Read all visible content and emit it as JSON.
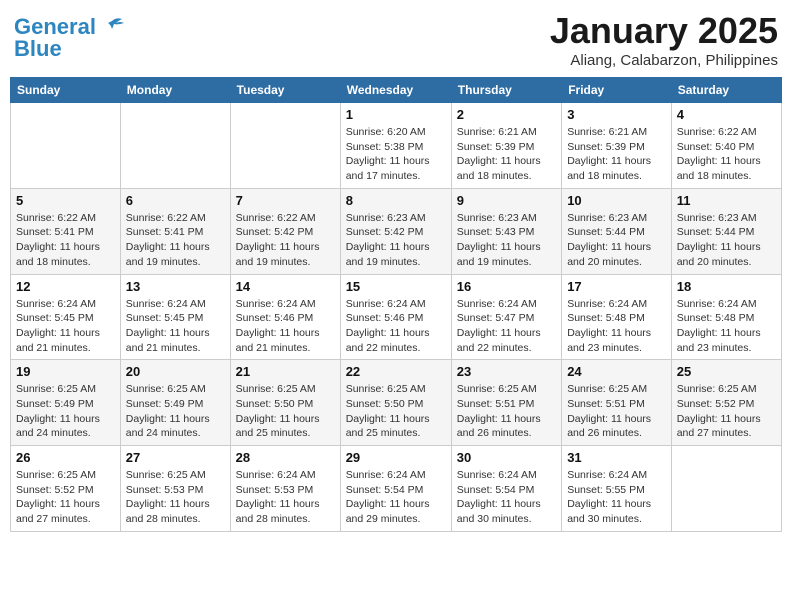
{
  "header": {
    "logo_line1": "General",
    "logo_line2": "Blue",
    "month": "January 2025",
    "location": "Aliang, Calabarzon, Philippines"
  },
  "weekdays": [
    "Sunday",
    "Monday",
    "Tuesday",
    "Wednesday",
    "Thursday",
    "Friday",
    "Saturday"
  ],
  "weeks": [
    [
      {
        "day": "",
        "sunrise": "",
        "sunset": "",
        "daylight": ""
      },
      {
        "day": "",
        "sunrise": "",
        "sunset": "",
        "daylight": ""
      },
      {
        "day": "",
        "sunrise": "",
        "sunset": "",
        "daylight": ""
      },
      {
        "day": "1",
        "sunrise": "Sunrise: 6:20 AM",
        "sunset": "Sunset: 5:38 PM",
        "daylight": "Daylight: 11 hours and 17 minutes."
      },
      {
        "day": "2",
        "sunrise": "Sunrise: 6:21 AM",
        "sunset": "Sunset: 5:39 PM",
        "daylight": "Daylight: 11 hours and 18 minutes."
      },
      {
        "day": "3",
        "sunrise": "Sunrise: 6:21 AM",
        "sunset": "Sunset: 5:39 PM",
        "daylight": "Daylight: 11 hours and 18 minutes."
      },
      {
        "day": "4",
        "sunrise": "Sunrise: 6:22 AM",
        "sunset": "Sunset: 5:40 PM",
        "daylight": "Daylight: 11 hours and 18 minutes."
      }
    ],
    [
      {
        "day": "5",
        "sunrise": "Sunrise: 6:22 AM",
        "sunset": "Sunset: 5:41 PM",
        "daylight": "Daylight: 11 hours and 18 minutes."
      },
      {
        "day": "6",
        "sunrise": "Sunrise: 6:22 AM",
        "sunset": "Sunset: 5:41 PM",
        "daylight": "Daylight: 11 hours and 19 minutes."
      },
      {
        "day": "7",
        "sunrise": "Sunrise: 6:22 AM",
        "sunset": "Sunset: 5:42 PM",
        "daylight": "Daylight: 11 hours and 19 minutes."
      },
      {
        "day": "8",
        "sunrise": "Sunrise: 6:23 AM",
        "sunset": "Sunset: 5:42 PM",
        "daylight": "Daylight: 11 hours and 19 minutes."
      },
      {
        "day": "9",
        "sunrise": "Sunrise: 6:23 AM",
        "sunset": "Sunset: 5:43 PM",
        "daylight": "Daylight: 11 hours and 19 minutes."
      },
      {
        "day": "10",
        "sunrise": "Sunrise: 6:23 AM",
        "sunset": "Sunset: 5:44 PM",
        "daylight": "Daylight: 11 hours and 20 minutes."
      },
      {
        "day": "11",
        "sunrise": "Sunrise: 6:23 AM",
        "sunset": "Sunset: 5:44 PM",
        "daylight": "Daylight: 11 hours and 20 minutes."
      }
    ],
    [
      {
        "day": "12",
        "sunrise": "Sunrise: 6:24 AM",
        "sunset": "Sunset: 5:45 PM",
        "daylight": "Daylight: 11 hours and 21 minutes."
      },
      {
        "day": "13",
        "sunrise": "Sunrise: 6:24 AM",
        "sunset": "Sunset: 5:45 PM",
        "daylight": "Daylight: 11 hours and 21 minutes."
      },
      {
        "day": "14",
        "sunrise": "Sunrise: 6:24 AM",
        "sunset": "Sunset: 5:46 PM",
        "daylight": "Daylight: 11 hours and 21 minutes."
      },
      {
        "day": "15",
        "sunrise": "Sunrise: 6:24 AM",
        "sunset": "Sunset: 5:46 PM",
        "daylight": "Daylight: 11 hours and 22 minutes."
      },
      {
        "day": "16",
        "sunrise": "Sunrise: 6:24 AM",
        "sunset": "Sunset: 5:47 PM",
        "daylight": "Daylight: 11 hours and 22 minutes."
      },
      {
        "day": "17",
        "sunrise": "Sunrise: 6:24 AM",
        "sunset": "Sunset: 5:48 PM",
        "daylight": "Daylight: 11 hours and 23 minutes."
      },
      {
        "day": "18",
        "sunrise": "Sunrise: 6:24 AM",
        "sunset": "Sunset: 5:48 PM",
        "daylight": "Daylight: 11 hours and 23 minutes."
      }
    ],
    [
      {
        "day": "19",
        "sunrise": "Sunrise: 6:25 AM",
        "sunset": "Sunset: 5:49 PM",
        "daylight": "Daylight: 11 hours and 24 minutes."
      },
      {
        "day": "20",
        "sunrise": "Sunrise: 6:25 AM",
        "sunset": "Sunset: 5:49 PM",
        "daylight": "Daylight: 11 hours and 24 minutes."
      },
      {
        "day": "21",
        "sunrise": "Sunrise: 6:25 AM",
        "sunset": "Sunset: 5:50 PM",
        "daylight": "Daylight: 11 hours and 25 minutes."
      },
      {
        "day": "22",
        "sunrise": "Sunrise: 6:25 AM",
        "sunset": "Sunset: 5:50 PM",
        "daylight": "Daylight: 11 hours and 25 minutes."
      },
      {
        "day": "23",
        "sunrise": "Sunrise: 6:25 AM",
        "sunset": "Sunset: 5:51 PM",
        "daylight": "Daylight: 11 hours and 26 minutes."
      },
      {
        "day": "24",
        "sunrise": "Sunrise: 6:25 AM",
        "sunset": "Sunset: 5:51 PM",
        "daylight": "Daylight: 11 hours and 26 minutes."
      },
      {
        "day": "25",
        "sunrise": "Sunrise: 6:25 AM",
        "sunset": "Sunset: 5:52 PM",
        "daylight": "Daylight: 11 hours and 27 minutes."
      }
    ],
    [
      {
        "day": "26",
        "sunrise": "Sunrise: 6:25 AM",
        "sunset": "Sunset: 5:52 PM",
        "daylight": "Daylight: 11 hours and 27 minutes."
      },
      {
        "day": "27",
        "sunrise": "Sunrise: 6:25 AM",
        "sunset": "Sunset: 5:53 PM",
        "daylight": "Daylight: 11 hours and 28 minutes."
      },
      {
        "day": "28",
        "sunrise": "Sunrise: 6:24 AM",
        "sunset": "Sunset: 5:53 PM",
        "daylight": "Daylight: 11 hours and 28 minutes."
      },
      {
        "day": "29",
        "sunrise": "Sunrise: 6:24 AM",
        "sunset": "Sunset: 5:54 PM",
        "daylight": "Daylight: 11 hours and 29 minutes."
      },
      {
        "day": "30",
        "sunrise": "Sunrise: 6:24 AM",
        "sunset": "Sunset: 5:54 PM",
        "daylight": "Daylight: 11 hours and 30 minutes."
      },
      {
        "day": "31",
        "sunrise": "Sunrise: 6:24 AM",
        "sunset": "Sunset: 5:55 PM",
        "daylight": "Daylight: 11 hours and 30 minutes."
      },
      {
        "day": "",
        "sunrise": "",
        "sunset": "",
        "daylight": ""
      }
    ]
  ]
}
